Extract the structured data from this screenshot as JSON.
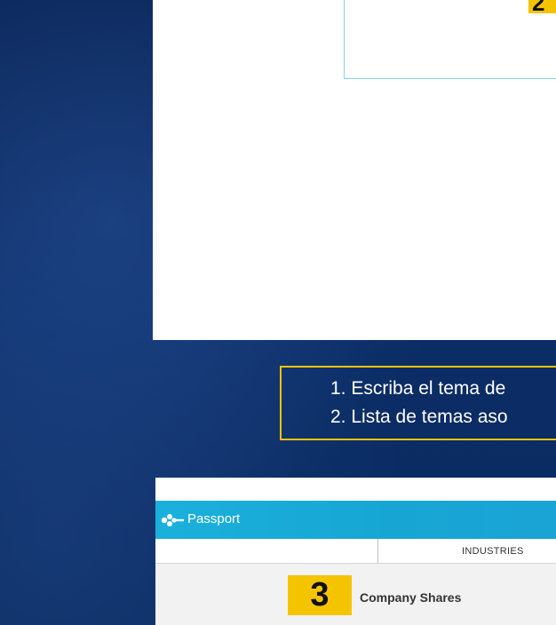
{
  "slide_top": {
    "badge_number": "2"
  },
  "instructions": {
    "lines": [
      "1. Escriba el tema de",
      "2. Lista de temas aso"
    ]
  },
  "passport": {
    "app_name": "Passport",
    "tabs": [
      "INDUSTRIES"
    ],
    "row": {
      "badge_number": "3",
      "label": "Company Shares"
    }
  },
  "colors": {
    "background": "#0b2a5e",
    "accent_yellow": "#f5c400",
    "header_blue": "#1bb0dc",
    "panel_white": "#ffffff"
  }
}
